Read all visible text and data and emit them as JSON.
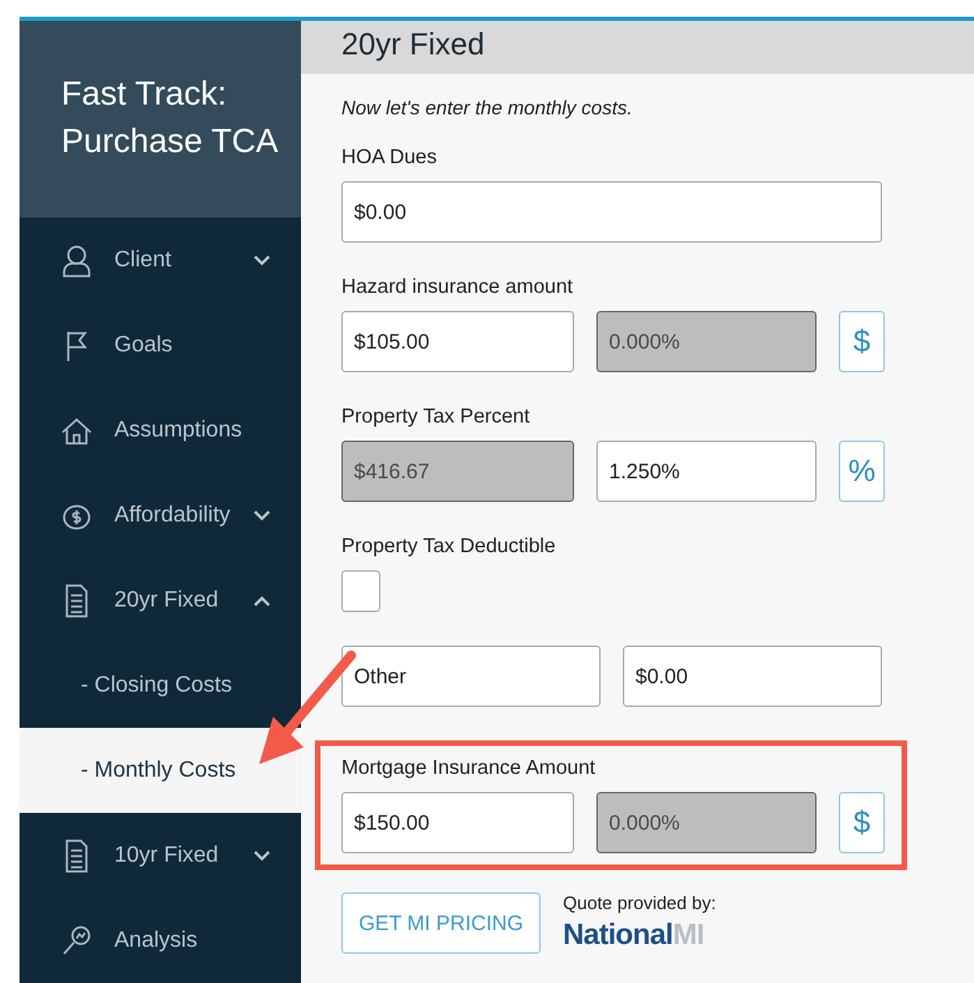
{
  "sidebar": {
    "title_lines": [
      "Fast Track:",
      "Purchase TCA"
    ],
    "items": [
      {
        "label": "Client",
        "expanded": false
      },
      {
        "label": "Goals"
      },
      {
        "label": "Assumptions"
      },
      {
        "label": "Affordability",
        "expanded": false
      },
      {
        "label": "20yr Fixed",
        "expanded": true,
        "children": [
          {
            "label": "- Closing Costs",
            "selected": false
          },
          {
            "label": "- Monthly Costs",
            "selected": true
          }
        ]
      },
      {
        "label": "10yr Fixed",
        "expanded": false
      },
      {
        "label": "Analysis"
      }
    ]
  },
  "main": {
    "title": "20yr Fixed",
    "intro": "Now let's enter the monthly costs.",
    "rows": [
      {
        "kind": "single",
        "label": "HOA Dues",
        "inputs": [
          {
            "value": "$0.00",
            "disabled": false
          }
        ]
      },
      {
        "kind": "pair_unit",
        "label": "Hazard insurance amount",
        "inputs": [
          {
            "value": "$105.00",
            "disabled": false
          },
          {
            "value": "0.000%",
            "disabled": true
          }
        ],
        "unit": "$"
      },
      {
        "kind": "pair_unit",
        "label": "Property Tax Percent",
        "inputs": [
          {
            "value": "$416.67",
            "disabled": true
          },
          {
            "value": "1.250%",
            "disabled": false
          }
        ],
        "unit": "%"
      },
      {
        "kind": "checkbox",
        "label": "Property Tax Deductible",
        "checked": false
      },
      {
        "kind": "pair",
        "inputs": [
          {
            "value": "Other",
            "disabled": false
          },
          {
            "value": "$0.00",
            "disabled": false
          }
        ]
      },
      {
        "kind": "pair_unit",
        "label": "Mortgage Insurance Amount",
        "inputs": [
          {
            "value": "$150.00",
            "disabled": false
          },
          {
            "value": "0.000%",
            "disabled": true
          }
        ],
        "unit": "$",
        "highlighted": true
      }
    ],
    "pricing_button": "GET MI PRICING",
    "quote_label": "Quote provided by:",
    "logo": {
      "word": "National",
      "suffix": "MI"
    }
  },
  "annotation_arrow": true
}
